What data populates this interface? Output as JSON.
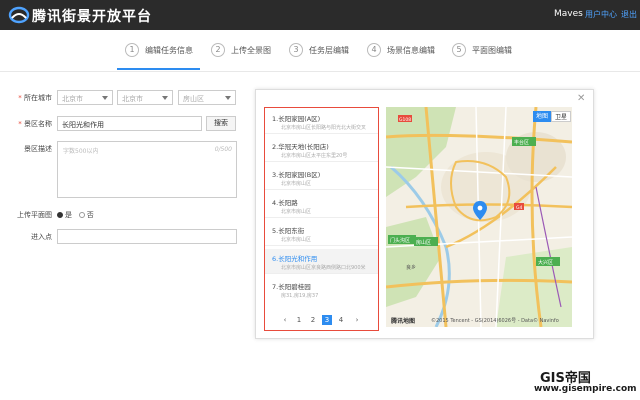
{
  "header": {
    "brand": "腾讯街景开放平台",
    "user": "Maves",
    "user_center": "用户中心",
    "logout": "退出"
  },
  "steps": [
    {
      "num": "1",
      "label": "编辑任务信息",
      "active": true
    },
    {
      "num": "2",
      "label": "上传全景图",
      "active": false
    },
    {
      "num": "3",
      "label": "任务层编辑",
      "active": false
    },
    {
      "num": "4",
      "label": "场景信息编辑",
      "active": false
    },
    {
      "num": "5",
      "label": "平面图编辑",
      "active": false
    }
  ],
  "form": {
    "city_label": "所在城市",
    "city_selects": [
      "北京市",
      "北京市",
      "房山区"
    ],
    "scene_label": "景区名称",
    "scene_value": "长阳光和作用",
    "search_button": "搜索",
    "desc_label": "景区描述",
    "desc_placeholder": "字数500以内",
    "desc_count": "0/500",
    "floor_label": "上传平面图",
    "radio_yes": "是",
    "radio_no": "否",
    "entry_label": "进入点"
  },
  "results": {
    "items": [
      {
        "title": "1.长阳家园(A区)",
        "addr": "北京市房山区长阳路与阳光北大街交叉",
        "selected": false
      },
      {
        "title": "2.华冠天地(长阳店)",
        "addr": "北京市房山区太平庄东里20号",
        "selected": false
      },
      {
        "title": "3.长阳家园(B区)",
        "addr": "北京市房山区",
        "selected": false
      },
      {
        "title": "4.长阳路",
        "addr": "北京市房山区",
        "selected": false
      },
      {
        "title": "5.长阳东街",
        "addr": "北京市房山区",
        "selected": false
      },
      {
        "title": "6.长阳光和作用",
        "addr": "北京市房山区京良路西侧路口北900米",
        "selected": true
      },
      {
        "title": "7.长阳碧桂园",
        "addr": "房31,房19,房37",
        "selected": false
      }
    ],
    "pager": {
      "prev": "‹",
      "pages": [
        "1",
        "2",
        "3",
        "4"
      ],
      "current": "3",
      "next": "›"
    }
  },
  "map": {
    "type_map": "地图",
    "type_satellite": "卫星",
    "logo": "腾讯地图",
    "copyright": "©2015 Tencent - GS(2014)6026号 - Data© Navinfo",
    "labels": [
      "门头沟区",
      "丰台区",
      "房山区",
      "大兴区",
      "良乡",
      "G108",
      "G4"
    ],
    "colors": {
      "water": "#9ccbe8",
      "green": "#cfe3b5",
      "urban": "#ede6d6",
      "highway": "#f2c15c",
      "road": "#ffffff",
      "pin": "#2d8cf0"
    }
  },
  "watermark": {
    "cn": "GIS帝国",
    "url": "www.gisempire.com"
  }
}
